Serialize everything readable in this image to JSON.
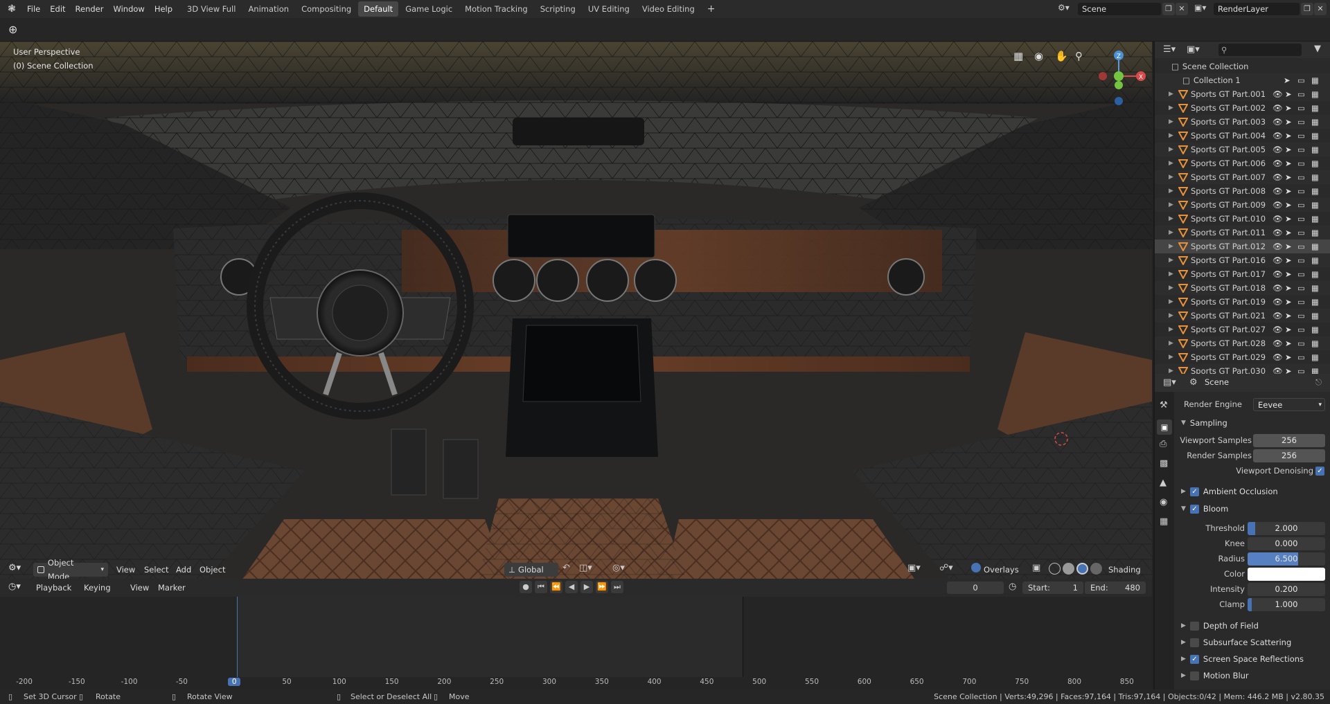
{
  "topbar": {
    "menus": [
      "File",
      "Edit",
      "Render",
      "Window",
      "Help"
    ],
    "workspaces": [
      "3D View Full",
      "Animation",
      "Compositing",
      "Default",
      "Game Logic",
      "Motion Tracking",
      "Scripting",
      "UV Editing",
      "Video Editing"
    ],
    "active_workspace": "Default",
    "add_tab": "+",
    "scene_name": "Scene",
    "view_layer": "RenderLayer"
  },
  "viewport": {
    "perspective_label": "User Perspective",
    "collection_label": "(0) Scene Collection",
    "gizmo_axes": {
      "x": "X",
      "y": "Y",
      "z": "Z"
    },
    "header": {
      "mode": "Object Mode",
      "menus": [
        "View",
        "Select",
        "Add",
        "Object"
      ],
      "transform_orientation": "Global",
      "overlays": "Overlays",
      "shading": "Shading"
    }
  },
  "timeline": {
    "menus": [
      "Playback",
      "Keying",
      "View",
      "Marker"
    ],
    "current_frame": "0",
    "start_label": "Start:",
    "start": "1",
    "end_label": "End:",
    "end": "480",
    "ruler_ticks": [
      "-200",
      "-150",
      "-100",
      "-50",
      "0",
      "50",
      "100",
      "150",
      "200",
      "250",
      "300",
      "350",
      "400",
      "450",
      "500",
      "550",
      "600",
      "650",
      "700",
      "750",
      "800",
      "850"
    ],
    "current_tick": "0"
  },
  "outliner": {
    "root": "Scene Collection",
    "collection": "Collection 1",
    "items": [
      "Sports GT Part.001",
      "Sports GT Part.002",
      "Sports GT Part.003",
      "Sports GT Part.004",
      "Sports GT Part.005",
      "Sports GT Part.006",
      "Sports GT Part.007",
      "Sports GT Part.008",
      "Sports GT Part.009",
      "Sports GT Part.010",
      "Sports GT Part.011",
      "Sports GT Part.012",
      "Sports GT Part.016",
      "Sports GT Part.017",
      "Sports GT Part.018",
      "Sports GT Part.019",
      "Sports GT Part.021",
      "Sports GT Part.027",
      "Sports GT Part.028",
      "Sports GT Part.029",
      "Sports GT Part.030"
    ],
    "selected_index": 11,
    "object_color": "#e8913a"
  },
  "properties": {
    "context": "Scene",
    "render_engine_label": "Render Engine",
    "render_engine": "Eevee",
    "sampling": {
      "title": "Sampling",
      "viewport_samples_label": "Viewport Samples",
      "viewport_samples": "256",
      "render_samples_label": "Render Samples",
      "render_samples": "256",
      "viewport_denoising_label": "Viewport Denoising"
    },
    "ambient_occlusion": "Ambient Occlusion",
    "bloom": {
      "title": "Bloom",
      "threshold_label": "Threshold",
      "threshold": "2.000",
      "threshold_fill": 0.1,
      "knee_label": "Knee",
      "knee": "0.000",
      "knee_fill": 0.0,
      "radius_label": "Radius",
      "radius": "6.500",
      "radius_fill": 0.65,
      "color_label": "Color",
      "color": "#ffffff",
      "intensity_label": "Intensity",
      "intensity": "0.200",
      "intensity_fill": 0.0,
      "clamp_label": "Clamp",
      "clamp": "1.000",
      "clamp_fill": 0.05
    },
    "depth_of_field": "Depth of Field",
    "subsurface_scattering": "Subsurface Scattering",
    "screen_space_reflections": "Screen Space Reflections",
    "motion_blur": "Motion Blur"
  },
  "statusbar": {
    "hint1": "Set 3D Cursor",
    "hint2": "Rotate",
    "hint3": "Rotate View",
    "hint4": "Select or Deselect All",
    "hint5": "Move",
    "stats": "Scene Collection | Verts:49,296 | Faces:97,164 | Tris:97,164 | Objects:0/42 | Mem: 446.2 MB | v2.80.35"
  },
  "colors": {
    "accent": "#4772b3",
    "active_field": "#5680c2"
  }
}
